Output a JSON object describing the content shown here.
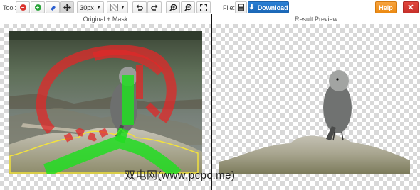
{
  "toolbar": {
    "tool_label": "Tool:",
    "brush_size": "30px",
    "file_label": "File:",
    "download_label": "Download",
    "help_label": "Help",
    "close_label": "✕"
  },
  "panes": {
    "left_title": "Original + Mask",
    "right_title": "Result Preview"
  },
  "watermark": "双电网(www.pcpc.me)",
  "icons": {
    "remove_brush": "minus-circle-icon",
    "add_brush": "plus-circle-icon",
    "eraser": "eraser-icon",
    "pan": "move-arrows-icon",
    "background": "background-square-icon",
    "undo": "undo-icon",
    "redo": "redo-icon",
    "zoom_in": "zoom-in-icon",
    "zoom_out": "zoom-out-icon",
    "fullscreen": "fullscreen-icon",
    "save": "floppy-disk-icon",
    "download": "download-arrow-icon"
  },
  "colors": {
    "download": "#1b67b6",
    "help": "#ec8a12",
    "close": "#c8302a",
    "mask_red": "#e02828",
    "mask_green": "#22dd22"
  }
}
